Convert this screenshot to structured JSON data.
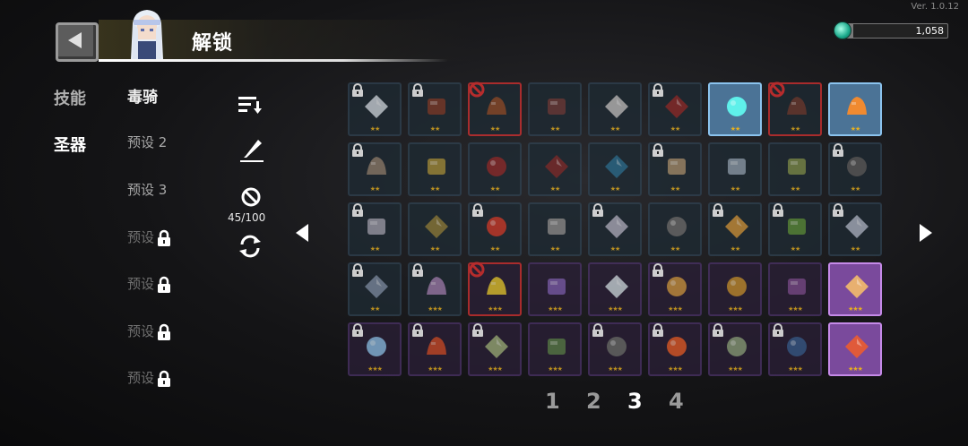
{
  "version": "Ver. 1.0.12",
  "header": {
    "title": "解锁",
    "currency_value": "1,058",
    "currency_fill": 0.08
  },
  "categories": [
    {
      "label": "技能",
      "active": false
    },
    {
      "label": "圣器",
      "active": true
    }
  ],
  "presets": [
    {
      "label": "毒骑",
      "state": "active"
    },
    {
      "label": "预设 2",
      "state": "normal"
    },
    {
      "label": "预设 3",
      "state": "normal"
    },
    {
      "label": "预设",
      "state": "locked"
    },
    {
      "label": "预设",
      "state": "locked"
    },
    {
      "label": "预设",
      "state": "locked"
    },
    {
      "label": "预设",
      "state": "locked"
    }
  ],
  "tools": {
    "count": "45/100"
  },
  "pages": [
    "1",
    "2",
    "3",
    "4"
  ],
  "current_page": "3",
  "grid": [
    {
      "status": "locked",
      "stars": 2,
      "icon": "frost-icon",
      "color": "#c8d0d8"
    },
    {
      "status": "locked",
      "stars": 2,
      "icon": "drum-icon",
      "color": "#7a3a2a"
    },
    {
      "status": "blocked",
      "stars": 2,
      "icon": "barrel-icon",
      "color": "#8a4a2a"
    },
    {
      "status": "normal",
      "stars": 2,
      "icon": "seed-icon",
      "color": "#6a3a38"
    },
    {
      "status": "normal",
      "stars": 2,
      "icon": "skull-icon",
      "color": "#b8b8b8"
    },
    {
      "status": "locked",
      "stars": 2,
      "icon": "blade-icon",
      "color": "#8a2a2a"
    },
    {
      "status": "highlight",
      "stars": 2,
      "icon": "crystal-icon",
      "color": "#5ff0ea"
    },
    {
      "status": "blocked",
      "stars": 2,
      "icon": "stones-icon",
      "color": "#6a3a30"
    },
    {
      "status": "highlight",
      "stars": 2,
      "icon": "rocket-icon",
      "color": "#f08a30"
    },
    {
      "status": "locked",
      "stars": 2,
      "icon": "scroll-icon",
      "color": "#8a7a6a"
    },
    {
      "status": "normal",
      "stars": 2,
      "icon": "boot-icon",
      "color": "#a08a3a"
    },
    {
      "status": "normal",
      "stars": 2,
      "icon": "feather-icon",
      "color": "#8a2a2a"
    },
    {
      "status": "normal",
      "stars": 2,
      "icon": "pentagram-icon",
      "color": "#7a2a2a"
    },
    {
      "status": "normal",
      "stars": 2,
      "icon": "flame-icon",
      "color": "#2a6a8a"
    },
    {
      "status": "locked",
      "stars": 2,
      "icon": "mask-icon",
      "color": "#a08a6a"
    },
    {
      "status": "normal",
      "stars": 2,
      "icon": "rock-icon",
      "color": "#8a9aa8"
    },
    {
      "status": "normal",
      "stars": 2,
      "icon": "gems-icon",
      "color": "#7a8a4a"
    },
    {
      "status": "locked",
      "stars": 2,
      "icon": "ufo-icon",
      "color": "#5a5a5a"
    },
    {
      "status": "locked",
      "stars": 2,
      "icon": "crescent-icon",
      "color": "#9a9aa8"
    },
    {
      "status": "normal",
      "stars": 2,
      "icon": "cloak-icon",
      "color": "#8a7a3a"
    },
    {
      "status": "locked",
      "stars": 2,
      "icon": "pennant-icon",
      "color": "#c83a2a"
    },
    {
      "status": "normal",
      "stars": 2,
      "icon": "gauntlet-icon",
      "color": "#8a8a8a"
    },
    {
      "status": "locked",
      "stars": 2,
      "icon": "apple-icon",
      "color": "#a8a8b8"
    },
    {
      "status": "normal",
      "stars": 2,
      "icon": "orb-icon",
      "color": "#6a6a6a"
    },
    {
      "status": "locked",
      "stars": 2,
      "icon": "medal-icon",
      "color": "#c8903a"
    },
    {
      "status": "locked",
      "stars": 2,
      "icon": "leaf-icon",
      "color": "#5a8a3a"
    },
    {
      "status": "locked",
      "stars": 2,
      "icon": "wings-icon",
      "color": "#a8b0c0"
    },
    {
      "status": "locked",
      "stars": 2,
      "icon": "chain-icon",
      "color": "#7a8aa0"
    },
    {
      "status": "locked",
      "stars": 3,
      "icon": "quartz-icon",
      "color": "#9a7aa8"
    },
    {
      "status": "blocked",
      "stars": 3,
      "icon": "potion-icon",
      "color": "#e0c030"
    },
    {
      "status": "normal",
      "stars": 3,
      "icon": "tome-icon",
      "color": "#7a5aa8"
    },
    {
      "status": "normal",
      "stars": 3,
      "icon": "stone-icon",
      "color": "#c8d0d8"
    },
    {
      "status": "locked",
      "stars": 3,
      "icon": "box-icon",
      "color": "#c89040"
    },
    {
      "status": "normal",
      "stars": 3,
      "icon": "chalice-icon",
      "color": "#c08a30"
    },
    {
      "status": "normal",
      "stars": 3,
      "icon": "book-icon",
      "color": "#7a4a8a"
    },
    {
      "status": "highlight",
      "stars": 3,
      "icon": "brain-icon",
      "color": "#e8b070"
    },
    {
      "status": "locked",
      "stars": 3,
      "icon": "syringe-icon",
      "color": "#8ab8e0"
    },
    {
      "status": "locked",
      "stars": 3,
      "icon": "shield-icon",
      "color": "#c84a2a"
    },
    {
      "status": "locked",
      "stars": 3,
      "icon": "cross-icon",
      "color": "#9aa878"
    },
    {
      "status": "normal",
      "stars": 3,
      "icon": "card-icon",
      "color": "#5a7a4a"
    },
    {
      "status": "locked",
      "stars": 3,
      "icon": "gun-icon",
      "color": "#6a6a6a"
    },
    {
      "status": "locked",
      "stars": 3,
      "icon": "sun-icon",
      "color": "#e05a2a"
    },
    {
      "status": "locked",
      "stars": 3,
      "icon": "map-icon",
      "color": "#8a9a7a"
    },
    {
      "status": "locked",
      "stars": 3,
      "icon": "blaster-icon",
      "color": "#3a5a8a"
    },
    {
      "status": "highlight",
      "stars": 3,
      "icon": "torch-icon",
      "color": "#e05a3a"
    }
  ]
}
